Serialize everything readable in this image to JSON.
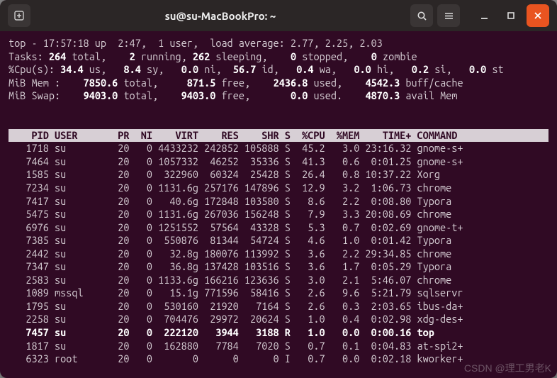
{
  "titlebar": {
    "title": "su@su-MacBookPro: ~"
  },
  "summary": {
    "line1_pre": "top - 17:57:18 up  2:47,  1 user,  load average: 2.77, 2.25, 2.03",
    "tasks": {
      "label": "Tasks:",
      "total": "264",
      "total_l": "total,",
      "running": "2",
      "running_l": "running,",
      "sleeping": "262",
      "sleeping_l": "sleeping,",
      "stopped": "0",
      "stopped_l": "stopped,",
      "zombie": "0",
      "zombie_l": "zombie"
    },
    "cpu": {
      "label": "%Cpu(s):",
      "us": "34.4",
      "us_l": "us,",
      "sy": "8.4",
      "sy_l": "sy,",
      "ni": "0.0",
      "ni_l": "ni,",
      "id": "56.7",
      "id_l": "id,",
      "wa": "0.4",
      "wa_l": "wa,",
      "hi": "0.0",
      "hi_l": "hi,",
      "si": "0.2",
      "si_l": "si,",
      "st": "0.0",
      "st_l": "st"
    },
    "mem": {
      "label": "MiB Mem :",
      "total": "7850.6",
      "total_l": "total,",
      "free": "871.5",
      "free_l": "free,",
      "used": "2436.8",
      "used_l": "used,",
      "buff": "4542.3",
      "buff_l": "buff/cache"
    },
    "swap": {
      "label": "MiB Swap:",
      "total": "9403.0",
      "total_l": "total,",
      "free": "9403.0",
      "free_l": "free,",
      "used": "0.0",
      "used_l": "used.",
      "avail": "4870.3",
      "avail_l": "avail Mem"
    }
  },
  "headers": [
    "PID",
    "USER",
    "PR",
    "NI",
    "VIRT",
    "RES",
    "SHR",
    "S",
    "%CPU",
    "%MEM",
    "TIME+",
    "COMMAND"
  ],
  "rows": [
    {
      "pid": "1718",
      "user": "su",
      "pr": "20",
      "ni": "0",
      "virt": "4433232",
      "res": "242852",
      "shr": "105888",
      "s": "S",
      "cpu": "45.2",
      "mem": "3.0",
      "time": "23:16.32",
      "cmd": "gnome-s+",
      "bold": false
    },
    {
      "pid": "7464",
      "user": "su",
      "pr": "20",
      "ni": "0",
      "virt": "1057332",
      "res": "46252",
      "shr": "35336",
      "s": "S",
      "cpu": "41.3",
      "mem": "0.6",
      "time": "0:01.25",
      "cmd": "gnome-s+",
      "bold": false
    },
    {
      "pid": "1585",
      "user": "su",
      "pr": "20",
      "ni": "0",
      "virt": "322960",
      "res": "60324",
      "shr": "25428",
      "s": "S",
      "cpu": "26.4",
      "mem": "0.8",
      "time": "10:37.22",
      "cmd": "Xorg",
      "bold": false
    },
    {
      "pid": "7234",
      "user": "su",
      "pr": "20",
      "ni": "0",
      "virt": "1131.6g",
      "res": "257176",
      "shr": "147896",
      "s": "S",
      "cpu": "12.9",
      "mem": "3.2",
      "time": "1:06.73",
      "cmd": "chrome",
      "bold": false
    },
    {
      "pid": "7417",
      "user": "su",
      "pr": "20",
      "ni": "0",
      "virt": "40.6g",
      "res": "172848",
      "shr": "103580",
      "s": "S",
      "cpu": "8.6",
      "mem": "2.2",
      "time": "0:08.80",
      "cmd": "Typora",
      "bold": false
    },
    {
      "pid": "5475",
      "user": "su",
      "pr": "20",
      "ni": "0",
      "virt": "1131.6g",
      "res": "267036",
      "shr": "156248",
      "s": "S",
      "cpu": "7.9",
      "mem": "3.3",
      "time": "20:08.69",
      "cmd": "chrome",
      "bold": false
    },
    {
      "pid": "6976",
      "user": "su",
      "pr": "20",
      "ni": "0",
      "virt": "1251552",
      "res": "57564",
      "shr": "43328",
      "s": "S",
      "cpu": "5.3",
      "mem": "0.7",
      "time": "0:02.69",
      "cmd": "gnome-t+",
      "bold": false
    },
    {
      "pid": "7385",
      "user": "su",
      "pr": "20",
      "ni": "0",
      "virt": "550876",
      "res": "81344",
      "shr": "54724",
      "s": "S",
      "cpu": "4.6",
      "mem": "1.0",
      "time": "0:01.42",
      "cmd": "Typora",
      "bold": false
    },
    {
      "pid": "2442",
      "user": "su",
      "pr": "20",
      "ni": "0",
      "virt": "32.8g",
      "res": "180076",
      "shr": "113992",
      "s": "S",
      "cpu": "3.6",
      "mem": "2.2",
      "time": "29:34.85",
      "cmd": "chrome",
      "bold": false
    },
    {
      "pid": "7347",
      "user": "su",
      "pr": "20",
      "ni": "0",
      "virt": "36.8g",
      "res": "137428",
      "shr": "103516",
      "s": "S",
      "cpu": "3.6",
      "mem": "1.7",
      "time": "0:05.29",
      "cmd": "Typora",
      "bold": false
    },
    {
      "pid": "2583",
      "user": "su",
      "pr": "20",
      "ni": "0",
      "virt": "1133.6g",
      "res": "166216",
      "shr": "123636",
      "s": "S",
      "cpu": "3.0",
      "mem": "2.1",
      "time": "5:46.07",
      "cmd": "chrome",
      "bold": false
    },
    {
      "pid": "1089",
      "user": "mssql",
      "pr": "20",
      "ni": "0",
      "virt": "15.1g",
      "res": "771596",
      "shr": "58416",
      "s": "S",
      "cpu": "2.6",
      "mem": "9.6",
      "time": "5:21.79",
      "cmd": "sqlservr",
      "bold": false
    },
    {
      "pid": "1795",
      "user": "su",
      "pr": "20",
      "ni": "0",
      "virt": "530160",
      "res": "21920",
      "shr": "7164",
      "s": "S",
      "cpu": "2.6",
      "mem": "0.3",
      "time": "2:03.65",
      "cmd": "ibus-da+",
      "bold": false
    },
    {
      "pid": "2258",
      "user": "su",
      "pr": "20",
      "ni": "0",
      "virt": "704476",
      "res": "29972",
      "shr": "20624",
      "s": "S",
      "cpu": "1.0",
      "mem": "0.4",
      "time": "0:02.98",
      "cmd": "xdg-des+",
      "bold": false
    },
    {
      "pid": "7457",
      "user": "su",
      "pr": "20",
      "ni": "0",
      "virt": "222120",
      "res": "3944",
      "shr": "3188",
      "s": "R",
      "cpu": "1.0",
      "mem": "0.0",
      "time": "0:00.16",
      "cmd": "top",
      "bold": true
    },
    {
      "pid": "1817",
      "user": "su",
      "pr": "20",
      "ni": "0",
      "virt": "162880",
      "res": "7784",
      "shr": "7020",
      "s": "S",
      "cpu": "0.7",
      "mem": "0.1",
      "time": "0:04.83",
      "cmd": "at-spi2+",
      "bold": false
    },
    {
      "pid": "6323",
      "user": "root",
      "pr": "20",
      "ni": "0",
      "virt": "0",
      "res": "0",
      "shr": "0",
      "s": "I",
      "cpu": "0.7",
      "mem": "0.0",
      "time": "0:02.18",
      "cmd": "kworker+",
      "bold": false
    }
  ],
  "watermark": "CSDN @理工男老K"
}
